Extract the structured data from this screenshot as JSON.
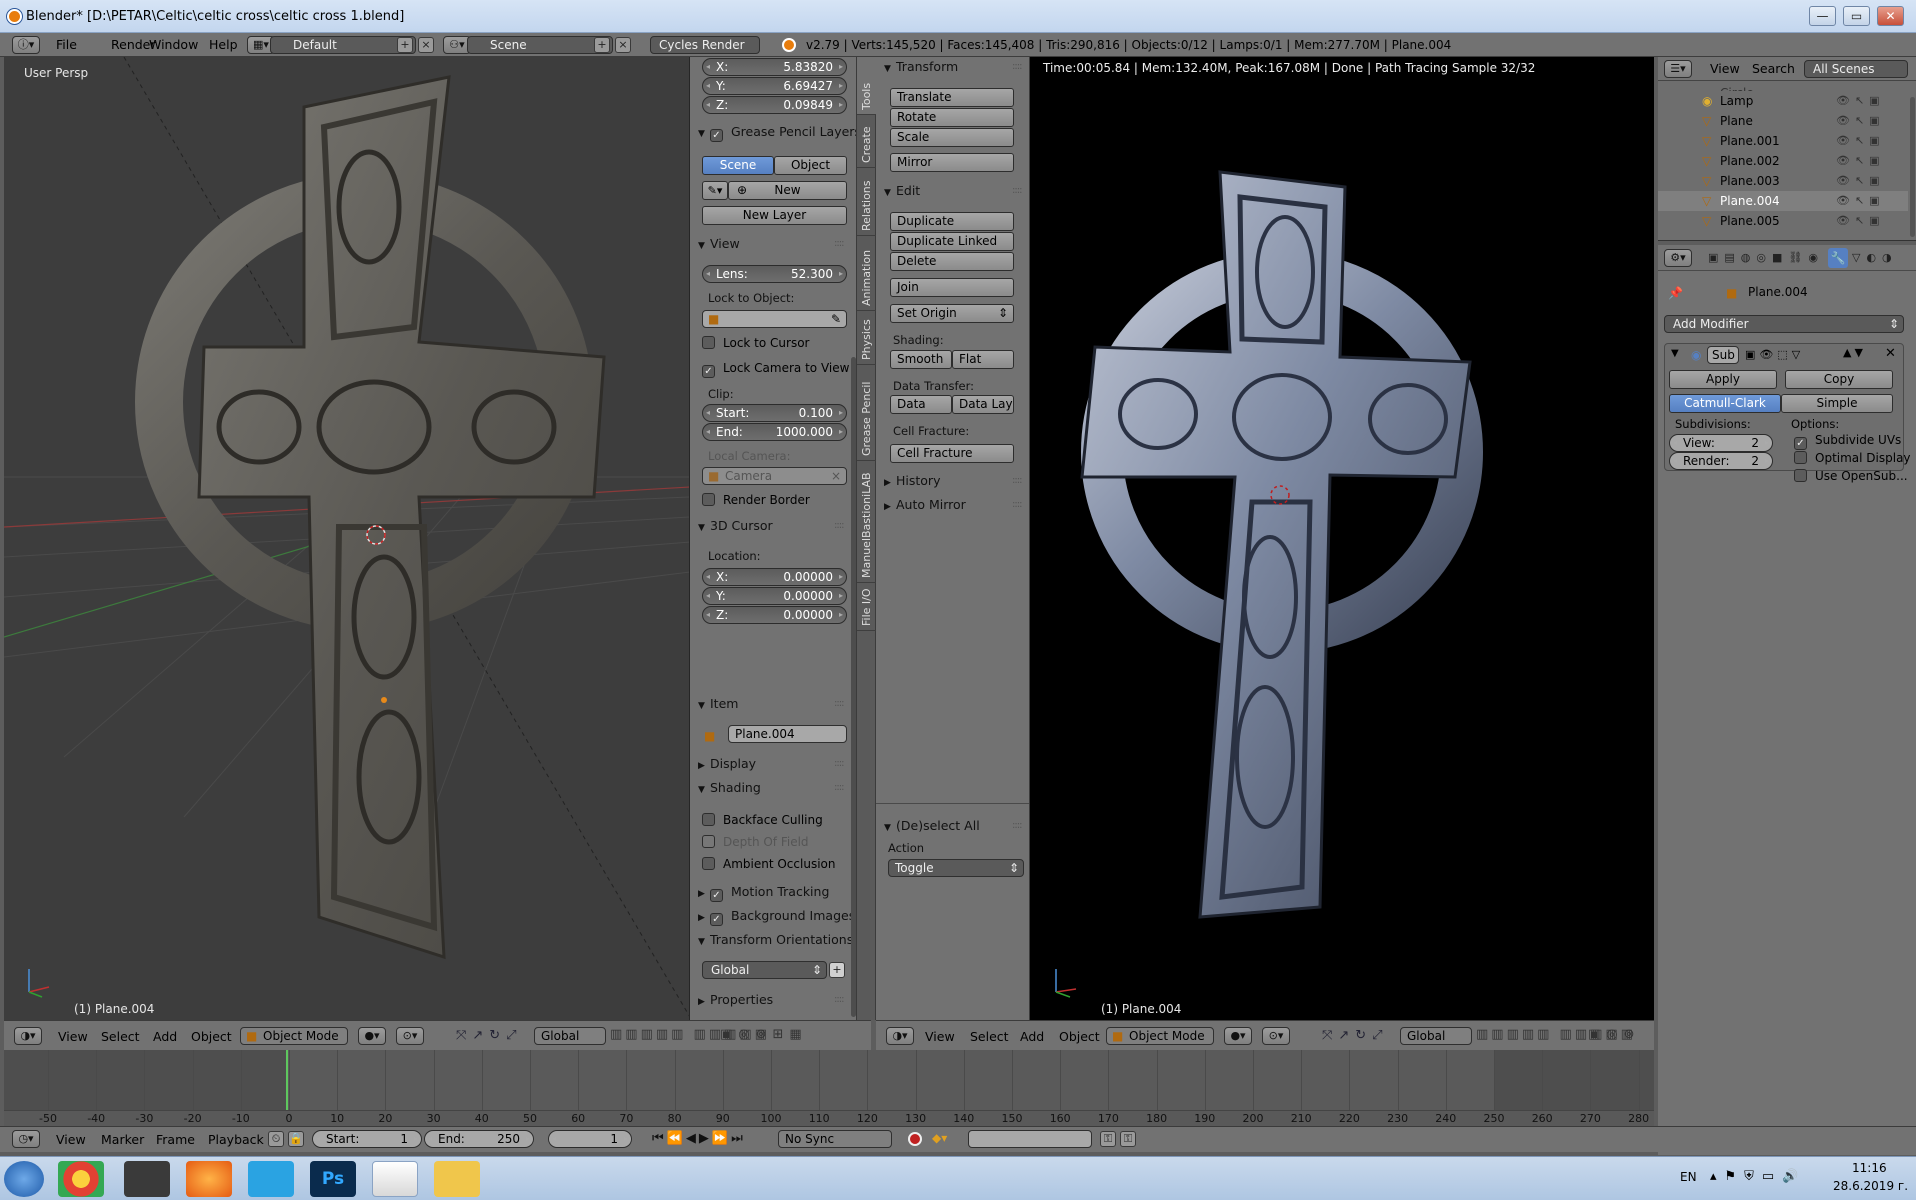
{
  "window": {
    "title": "Blender* [D:\\PETAR\\Celtic\\celtic cross\\celtic cross 1.blend]",
    "min_label": "—",
    "max_label": "▭",
    "close_label": "✕"
  },
  "infobar": {
    "menus": [
      "File",
      "Render",
      "Window",
      "Help"
    ],
    "layout": "Default",
    "scene": "Scene",
    "engine": "Cycles Render",
    "stats": "v2.79 | Verts:145,520 | Faces:145,408 | Tris:290,816 | Objects:0/12 | Lamps:0/1 | Mem:277.70M | Plane.004"
  },
  "left_viewport": {
    "label": "User Persp",
    "footer": "(1) Plane.004"
  },
  "right_viewport": {
    "render_info": "Time:00:05.84 | Mem:132.40M, Peak:167.08M | Done | Path Tracing Sample 32/32",
    "footer": "(1) Plane.004"
  },
  "npanel": {
    "loc_x": {
      "k": "X:",
      "v": "5.83820"
    },
    "loc_y": {
      "k": "Y:",
      "v": "6.69427"
    },
    "loc_z": {
      "k": "Z:",
      "v": "0.09849"
    },
    "grease_pencil": "Grease Pencil Layers",
    "gp_scene": "Scene",
    "gp_object": "Object",
    "gp_new": "New",
    "gp_new_layer": "New Layer",
    "view": "View",
    "lens": {
      "k": "Lens:",
      "v": "52.300"
    },
    "lock_to_object": "Lock to Object:",
    "lock_to_cursor": "Lock to Cursor",
    "lock_camera": "Lock Camera to View",
    "clip": "Clip:",
    "clip_start": {
      "k": "Start:",
      "v": "0.100"
    },
    "clip_end": {
      "k": "End:",
      "v": "1000.000"
    },
    "local_camera": "Local Camera:",
    "camera": "Camera",
    "render_border": "Render Border",
    "cursor3d": "3D Cursor",
    "location": "Location:",
    "cur_x": {
      "k": "X:",
      "v": "0.00000"
    },
    "cur_y": {
      "k": "Y:",
      "v": "0.00000"
    },
    "cur_z": {
      "k": "Z:",
      "v": "0.00000"
    },
    "item": "Item",
    "item_name": "Plane.004",
    "display": "Display",
    "shading": "Shading",
    "backface": "Backface Culling",
    "dof": "Depth Of Field",
    "ao": "Ambient Occlusion",
    "motion": "Motion Tracking",
    "bgimages": "Background Images",
    "transform_orient": "Transform Orientations",
    "global": "Global",
    "properties": "Properties"
  },
  "vtabs": [
    "Tools",
    "Create",
    "Relations",
    "Animation",
    "Physics",
    "Grease Pencil",
    "ManuelBastioniLAB",
    "File I/O"
  ],
  "toolshelf": {
    "transform": "Transform",
    "translate": "Translate",
    "rotate": "Rotate",
    "scale": "Scale",
    "mirror": "Mirror",
    "edit": "Edit",
    "duplicate": "Duplicate",
    "duplicate_linked": "Duplicate Linked",
    "delete": "Delete",
    "join": "Join",
    "set_origin": "Set Origin",
    "shading": "Shading:",
    "smooth": "Smooth",
    "flat": "Flat",
    "data_transfer": "Data Transfer:",
    "data": "Data",
    "data_layo": "Data Layo",
    "cell_fracture_lbl": "Cell Fracture:",
    "cell_fracture": "Cell Fracture",
    "history": "History",
    "auto_mirror": "Auto Mirror",
    "deselect_all": "(De)select All",
    "action": "Action",
    "toggle": "Toggle"
  },
  "outliner": {
    "view": "View",
    "search": "Search",
    "scenes": "All Scenes",
    "items": [
      "Circle",
      "Lamp",
      "Plane",
      "Plane.001",
      "Plane.002",
      "Plane.003",
      "Plane.004",
      "Plane.005"
    ]
  },
  "properties": {
    "object": "Plane.004",
    "add_modifier": "Add Modifier",
    "mod_name": "Sub",
    "apply": "Apply",
    "copy": "Copy",
    "catmull": "Catmull-Clark",
    "simple": "Simple",
    "subdivisions": "Subdivisions:",
    "options": "Options:",
    "view": {
      "k": "View:",
      "v": "2"
    },
    "render": {
      "k": "Render:",
      "v": "2"
    },
    "subdivide_uvs": "Subdivide UVs",
    "optimal_display": "Optimal Display",
    "use_opensubdiv": "Use OpenSub..."
  },
  "header3d": {
    "menus": [
      "View",
      "Select",
      "Add",
      "Object"
    ],
    "mode": "Object Mode",
    "orientation": "Global"
  },
  "timeline": {
    "ticks": [
      "-50",
      "-40",
      "-30",
      "-20",
      "-10",
      "0",
      "10",
      "20",
      "30",
      "40",
      "50",
      "60",
      "70",
      "80",
      "90",
      "100",
      "110",
      "120",
      "130",
      "140",
      "150",
      "160",
      "170",
      "180",
      "190",
      "200",
      "210",
      "220",
      "230",
      "240",
      "250",
      "260",
      "270",
      "280"
    ],
    "menus": [
      "View",
      "Marker",
      "Frame",
      "Playback"
    ],
    "start": {
      "k": "Start:",
      "v": "1"
    },
    "end": {
      "k": "End:",
      "v": "250"
    },
    "current": "1",
    "sync": "No Sync"
  },
  "taskbar": {
    "lang": "EN",
    "time": "11:16",
    "date": "28.6.2019 г."
  }
}
